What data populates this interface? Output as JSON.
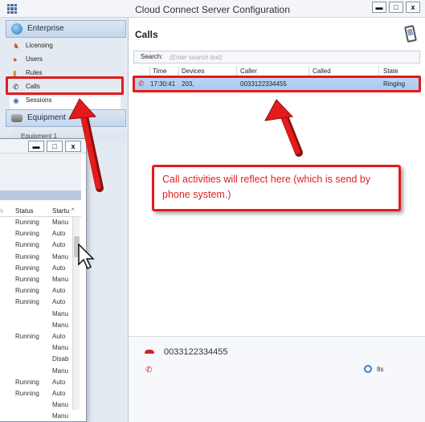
{
  "window": {
    "title": "Cloud Connect Server Configuration",
    "minimize": "▬",
    "maximize": "□",
    "close": "x"
  },
  "sidebar": {
    "sections": [
      {
        "label": "Enterprise",
        "icon": "globe-icon"
      },
      {
        "label": "Equipment",
        "icon": "device-icon"
      }
    ],
    "items": [
      {
        "label": "Licensing",
        "icon": "license-icon"
      },
      {
        "label": "Users",
        "icon": "user-icon"
      },
      {
        "label": "Rules",
        "icon": "rules-icon"
      },
      {
        "label": "Calls",
        "icon": "phone-icon"
      },
      {
        "label": "Sessions",
        "icon": "sessions-icon"
      }
    ],
    "equipment_item": "Equipment 1"
  },
  "services_window": {
    "minimize": "▬",
    "maximize": "□",
    "close": "x",
    "columns": [
      "Status",
      "Startu"
    ],
    "rows": [
      {
        "status": "Running",
        "startup": "Manu"
      },
      {
        "status": "Running",
        "startup": "Auto"
      },
      {
        "status": "Running",
        "startup": "Auto"
      },
      {
        "status": "Running",
        "startup": "Manu"
      },
      {
        "status": "Running",
        "startup": "Auto"
      },
      {
        "status": "Running",
        "startup": "Manu"
      },
      {
        "status": "Running",
        "startup": "Auto"
      },
      {
        "status": "Running",
        "startup": "Auto"
      },
      {
        "status": "",
        "startup": "Manu"
      },
      {
        "status": "",
        "startup": "Manu"
      },
      {
        "status": "Running",
        "startup": "Auto"
      },
      {
        "status": "",
        "startup": "Manu"
      },
      {
        "status": "",
        "startup": "Disab"
      },
      {
        "status": "",
        "startup": "Manu"
      },
      {
        "status": "Running",
        "startup": "Auto"
      },
      {
        "status": "Running",
        "startup": "Auto"
      },
      {
        "status": "",
        "startup": "Manu"
      },
      {
        "status": "",
        "startup": "Manu"
      }
    ]
  },
  "calls": {
    "title": "Calls",
    "search_label": "Search:",
    "search_placeholder": "(Enter search text)",
    "columns": [
      "Time",
      "Devices",
      "Caller",
      "Called",
      "State"
    ],
    "rows": [
      {
        "time": "17:30:41",
        "devices": "203,",
        "caller": "0033122334455",
        "called": "",
        "state": "Ringing"
      }
    ],
    "detail": {
      "number": "0033122334455",
      "timer": "8s"
    }
  },
  "annotation": {
    "text_line1": "Call activities will reflect here (which is send by",
    "text_line2": "phone system.)"
  },
  "colors": {
    "annotation_red": "#e31b1b",
    "selected_row": "#a8c9ee",
    "nav_header": "#c5d6ec"
  }
}
